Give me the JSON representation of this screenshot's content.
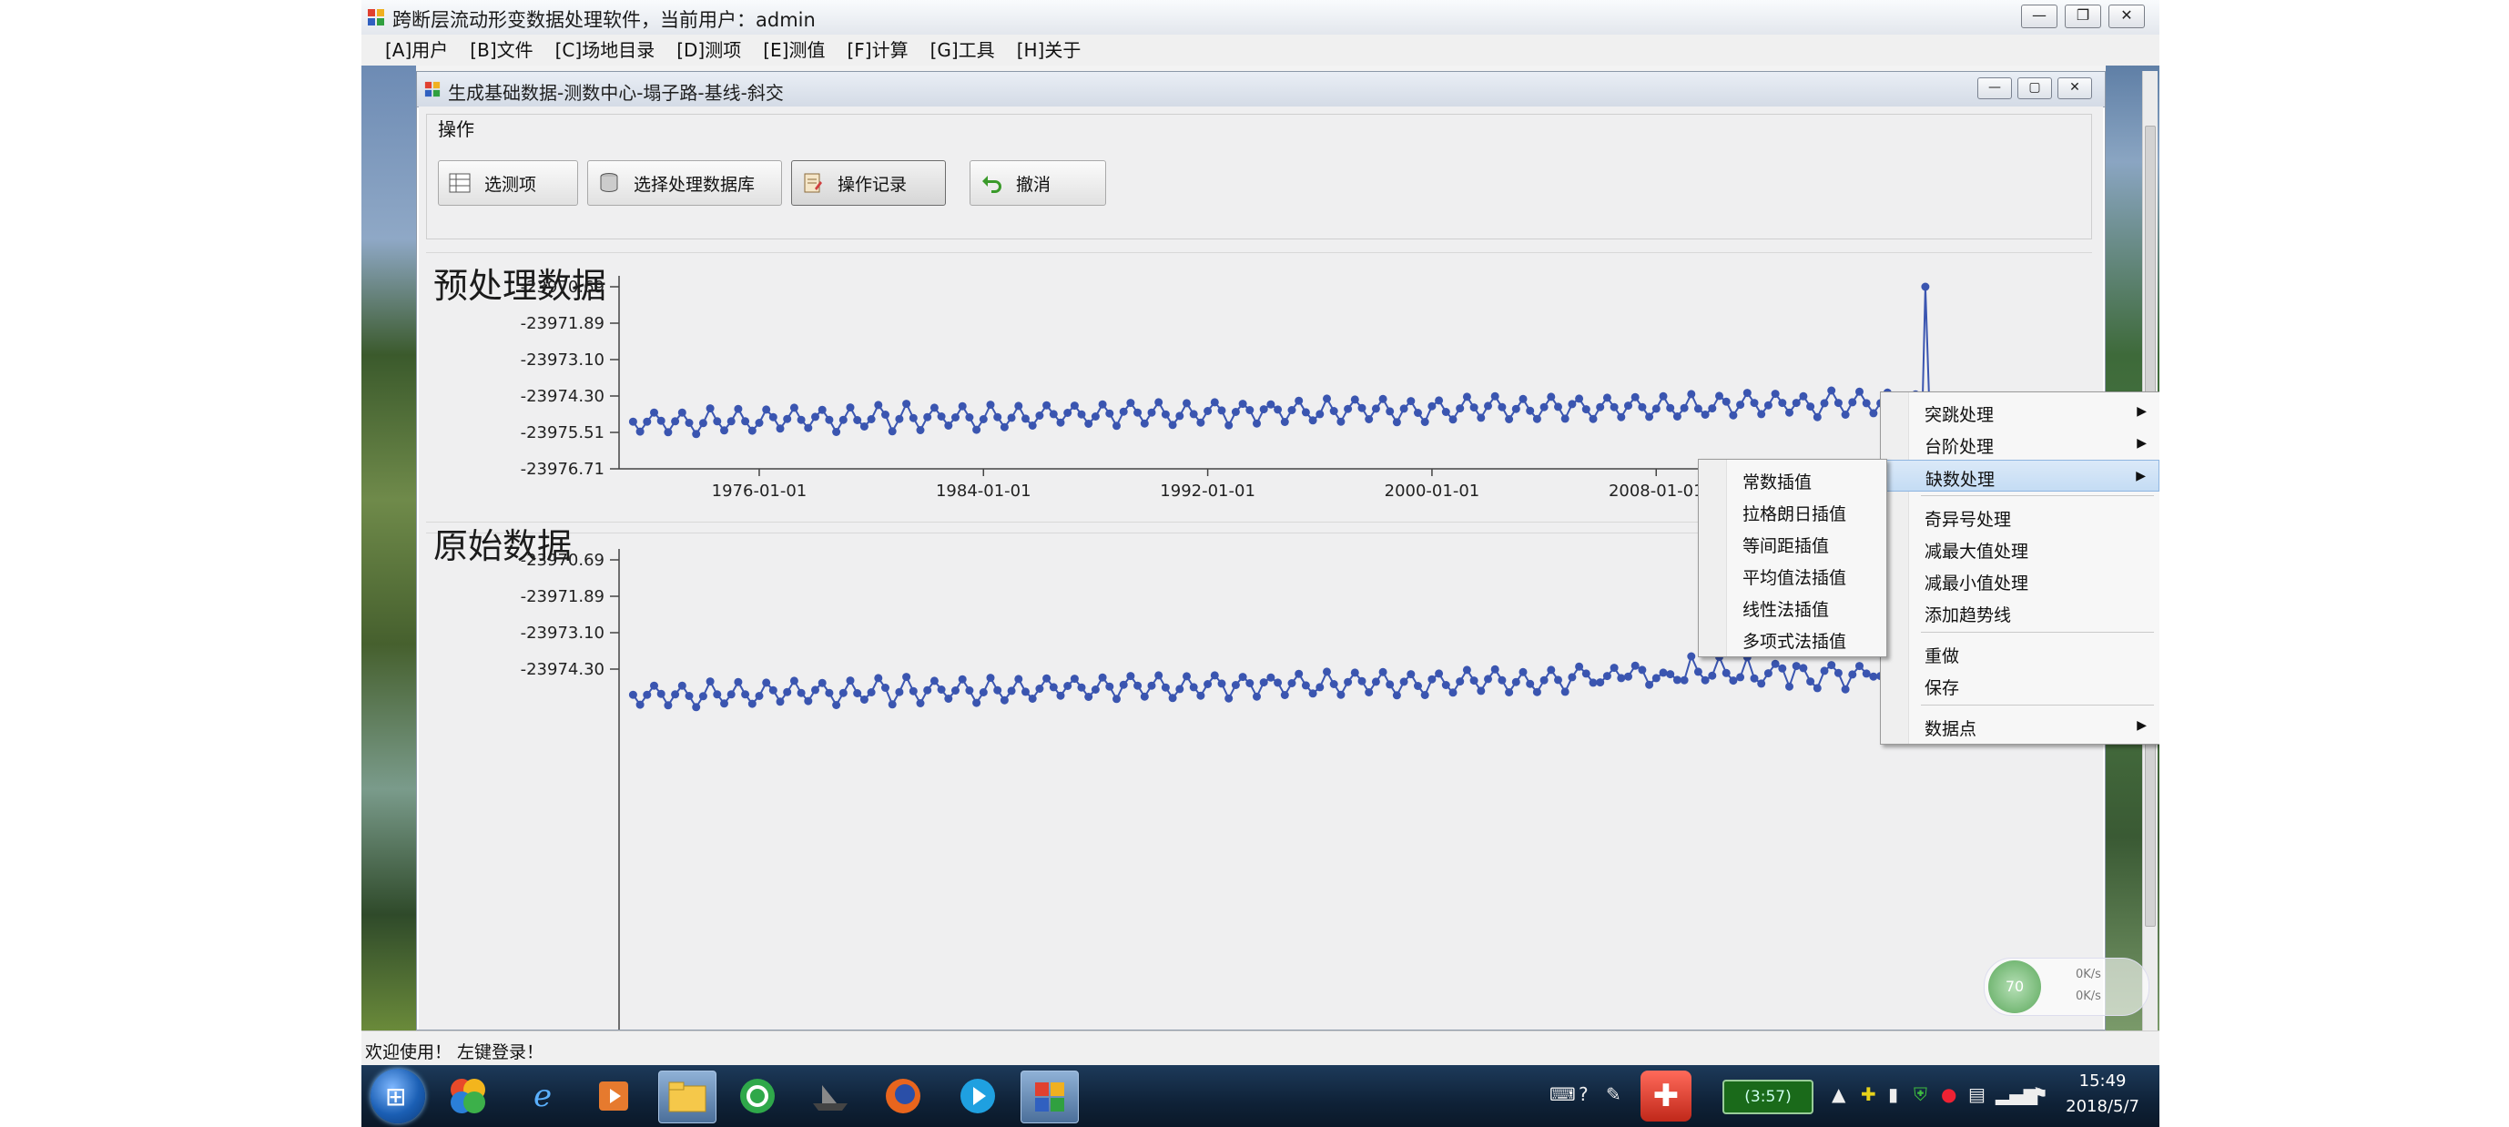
{
  "window": {
    "title": "跨断层流动形变数据处理软件，当前用户：admin",
    "controls": [
      "—",
      "❐",
      "✕"
    ]
  },
  "menu": [
    "[A]用户",
    "[B]文件",
    "[C]场地目录",
    "[D]测项",
    "[E]测值",
    "[F]计算",
    "[G]工具",
    "[H]关于"
  ],
  "child_window": {
    "title": "生成基础数据-测数中心-塌子路-基线-斜交",
    "controls": [
      "—",
      "▢",
      "✕"
    ]
  },
  "toolbar": {
    "group_label": "操作",
    "buttons": [
      {
        "label": "选测项",
        "icon": "table-icon"
      },
      {
        "label": "选择处理数据库",
        "icon": "database-icon"
      },
      {
        "label": "操作记录",
        "icon": "record-icon"
      },
      {
        "label": "撤消",
        "icon": "undo-icon"
      }
    ]
  },
  "charts_text": {
    "top_title": "预处理数据",
    "bottom_title": "原始数据"
  },
  "chart_data": [
    {
      "type": "line",
      "title": "预处理数据",
      "ylim": [
        -23976.71,
        -23970.69
      ],
      "y_ticks": [
        "-23970.69",
        "-23971.89",
        "-23973.10",
        "-23974.30",
        "-23975.51",
        "-23976.71"
      ],
      "x_ticks": [
        "1976-01-01",
        "1984-01-01",
        "1992-01-01",
        "2000-01-01",
        "2008-01-01"
      ],
      "xlim": [
        "1971-01-01",
        "2018-06-01"
      ],
      "series_color": "#3a55b0",
      "series": [
        {
          "name": "",
          "values": []
        }
      ],
      "note_values_desc": "seasonal oscillating series around -23975.0 slowly rising to about -23974.5, one spike to -23970.69 near 2017"
    },
    {
      "type": "line",
      "title": "原始数据",
      "ylim": [
        -23976.71,
        -23970.69
      ],
      "y_ticks": [
        "-23970.69",
        "-23971.89",
        "-23973.10",
        "-23974.30"
      ],
      "xlim": [
        "1971-01-01",
        "2018-06-01"
      ],
      "series_color": "#3a55b0",
      "series": [
        {
          "name": "",
          "values": []
        }
      ]
    }
  ],
  "context_menu": {
    "items": [
      {
        "label": "突跳处理",
        "submenu": true
      },
      {
        "label": "台阶处理",
        "submenu": true
      },
      {
        "label": "缺数处理",
        "submenu": true,
        "highlighted": true
      },
      {
        "sep": true
      },
      {
        "label": "奇异号处理",
        "submenu": false
      },
      {
        "label": "减最大值处理",
        "submenu": false
      },
      {
        "label": "减最小值处理",
        "submenu": false
      },
      {
        "label": "添加趋势线",
        "submenu": false
      },
      {
        "sep": true
      },
      {
        "label": "重做",
        "submenu": false
      },
      {
        "label": "保存",
        "submenu": false
      },
      {
        "sep": true
      },
      {
        "label": "数据点",
        "submenu": true
      }
    ],
    "submenu": [
      "常数插值",
      "拉格朗日插值",
      "等间距插值",
      "平均值法插值",
      "线性法插值",
      "多项式法插值"
    ]
  },
  "statusbar": {
    "text": "欢迎使用！ 左键登录！"
  },
  "taskbar": {
    "battery": "(3:57)",
    "time": "15:49",
    "date": "2018/5/7",
    "net_widget": "70",
    "net_up": "0K/s",
    "net_down": "0K/s"
  }
}
